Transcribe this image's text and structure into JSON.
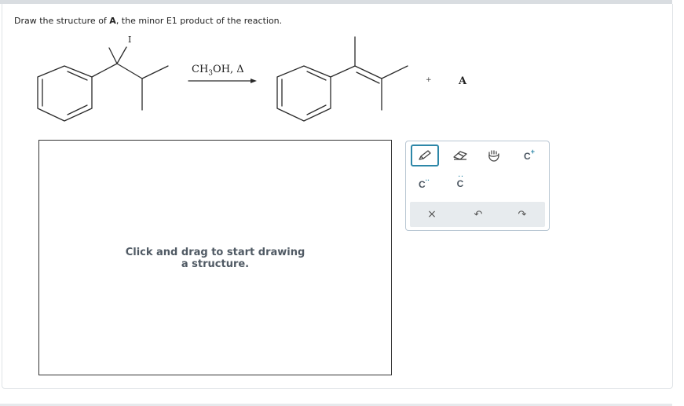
{
  "question": {
    "prefix": "Draw the structure of ",
    "bold": "A",
    "suffix": ", the minor E1 product of the reaction."
  },
  "reaction": {
    "halogen_label": "I",
    "reagent_main": "CH",
    "reagent_sub": "3",
    "reagent_rest": "OH, Δ",
    "plus": "+",
    "product_label": "A"
  },
  "canvas": {
    "placeholder": "Click and drag to start drawing a structure."
  },
  "toolbox": {
    "tools": [
      {
        "name": "pencil-icon",
        "label": "draw"
      },
      {
        "name": "eraser-icon",
        "label": "erase"
      },
      {
        "name": "hand-icon",
        "label": "move"
      },
      {
        "name": "carbocation",
        "text": "C",
        "sup": "+"
      },
      {
        "name": "carbanion",
        "text": "C",
        "sup": "··"
      },
      {
        "name": "lone-pair-carbon",
        "text": "C",
        "sup": ":"
      }
    ],
    "actions": [
      {
        "name": "clear",
        "glyph": "×"
      },
      {
        "name": "undo",
        "glyph": "↶"
      },
      {
        "name": "redo",
        "glyph": "↷"
      }
    ]
  }
}
